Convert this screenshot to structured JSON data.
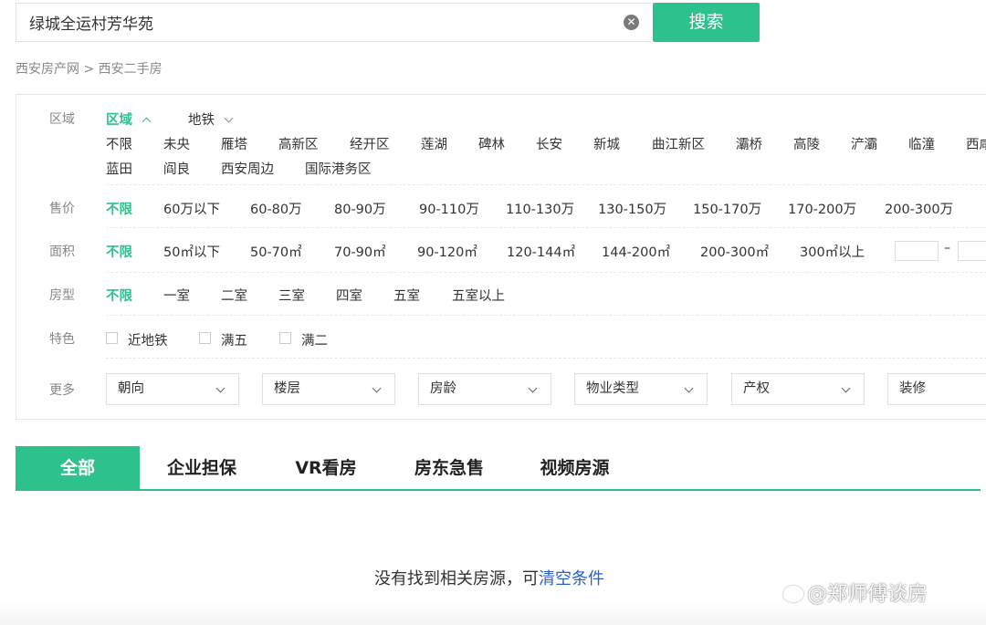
{
  "search": {
    "value": "绿城全运村芳华苑",
    "button": "搜索",
    "clear_icon": "close-circle-icon"
  },
  "breadcrumb": {
    "home": "西安房产网",
    "separator": ">",
    "current": "西安二手房"
  },
  "filters": {
    "region": {
      "label": "区域",
      "modes": [
        "区域",
        "地铁"
      ],
      "row1": [
        "不限",
        "未央",
        "雁塔",
        "高新区",
        "经开区",
        "莲湖",
        "碑林",
        "长安",
        "新城",
        "曲江新区",
        "灞桥",
        "高陵",
        "浐灞",
        "临潼",
        "西咸"
      ],
      "row2": [
        "蓝田",
        "阎良",
        "西安周边",
        "国际港务区"
      ]
    },
    "price": {
      "label": "售价",
      "options": [
        "不限",
        "60万以下",
        "60-80万",
        "80-90万",
        "90-110万",
        "110-130万",
        "130-150万",
        "150-170万",
        "170-200万",
        "200-300万"
      ]
    },
    "area": {
      "label": "面积",
      "options": [
        "不限",
        "50㎡以下",
        "50-70㎡",
        "70-90㎡",
        "90-120㎡",
        "120-144㎡",
        "144-200㎡",
        "200-300㎡",
        "300㎡以上"
      ],
      "range_dash": "–"
    },
    "layout": {
      "label": "房型",
      "options": [
        "不限",
        "一室",
        "二室",
        "三室",
        "四室",
        "五室",
        "五室以上"
      ]
    },
    "features": {
      "label": "特色",
      "options": [
        "近地铁",
        "满五",
        "满二"
      ]
    },
    "more": {
      "label": "更多",
      "dropdowns": [
        "朝向",
        "楼层",
        "房龄",
        "物业类型",
        "产权",
        "装修"
      ]
    }
  },
  "tabs": [
    "全部",
    "企业担保",
    "VR看房",
    "房东急售",
    "视频房源"
  ],
  "empty": {
    "message": "没有找到相关房源，可",
    "link": "清空条件"
  },
  "watermark": "@郑师傅谈房",
  "colors": {
    "accent": "#2dc28c",
    "link": "#2b62c2"
  }
}
